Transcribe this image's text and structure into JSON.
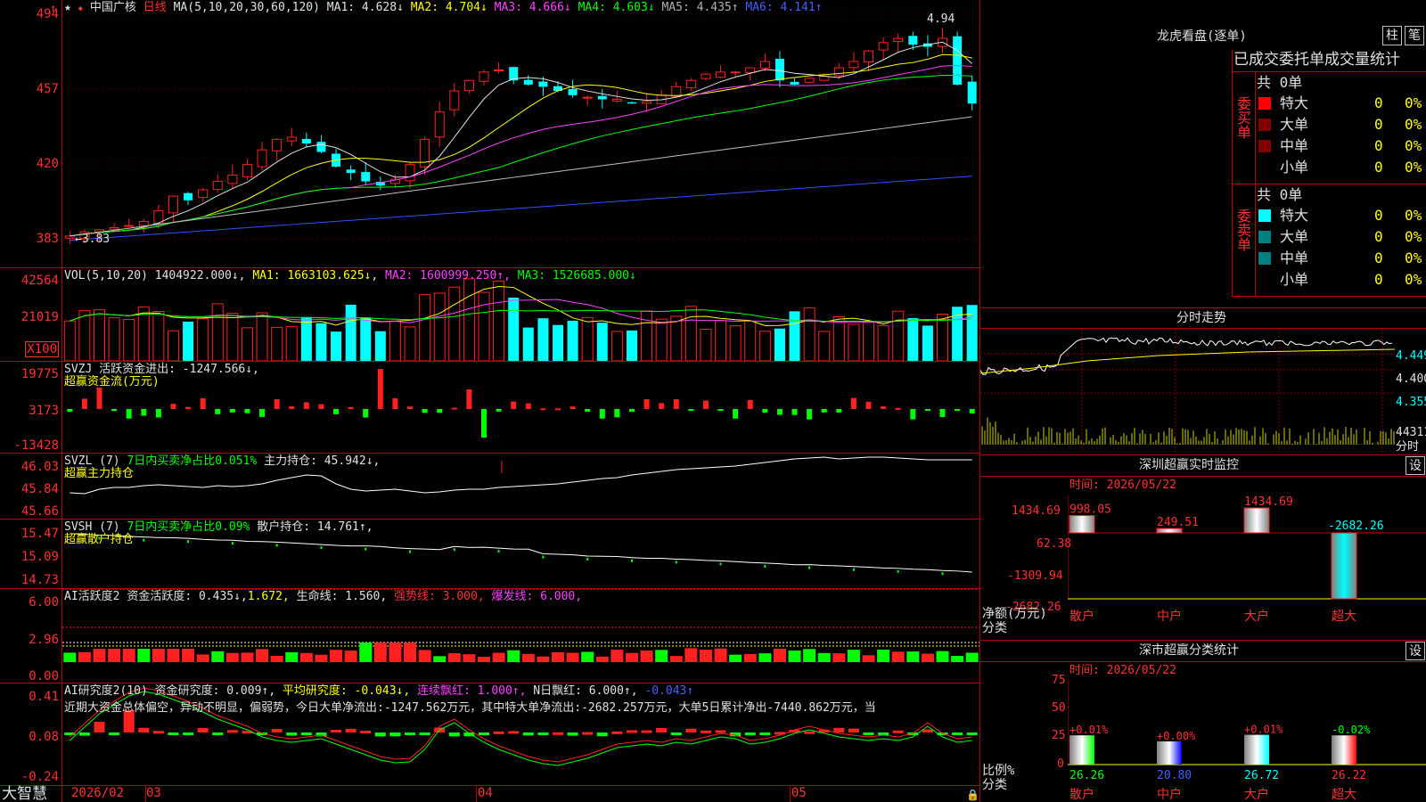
{
  "stock": {
    "name": "中国广核",
    "period": "日线",
    "star": "★"
  },
  "price_axis": [
    "494",
    "457",
    "420",
    "383"
  ],
  "ma_line": {
    "params": "MA(5,10,20,30,60,120)",
    "ma1": "MA1: 4.628↓",
    "ma2": "MA2: 4.704↓",
    "ma3": "MA3: 4.666↓",
    "ma4": "MA4: 4.603↓",
    "ma5": "MA5: 4.435↑",
    "ma6": "MA6: 4.141↑"
  },
  "high_label": "4.94",
  "low_label": "3.83",
  "vol": {
    "title": "VOL(5,10,20)",
    "value": "1404922.000↓,",
    "ma1": "MA1: 1663103.625↓,",
    "ma2": "MA2: 1600999.250↑,",
    "ma3": "MA3: 1526685.000↓",
    "axis": [
      "42564",
      "21019"
    ],
    "unit": "X100"
  },
  "svzj": {
    "title": "SVZJ  活跃资金进出: -1247.566↓,",
    "sub": "超赢资金流(万元)",
    "axis": [
      "19775",
      "3173",
      "-13428"
    ]
  },
  "svzl": {
    "title": "SVZL (7)",
    "t2": "7日内买卖净占比0.051%",
    "t3": "主力持仓: 45.942↓,",
    "sub": "超赢主力持仓",
    "axis": [
      "46.03",
      "45.84",
      "45.66"
    ]
  },
  "svsh": {
    "title": "SVSH (7)",
    "t2": "7日内买卖净占比0.09%",
    "t3": "散户持仓: 14.761↑,",
    "sub": "超赢散户持仓",
    "axis": [
      "15.47",
      "15.09",
      "14.73"
    ]
  },
  "ai1": {
    "title": "AI活跃度2",
    "t2": "资金活跃度: 0.435↓,",
    "t3": "1.672,",
    "t4": "生命线: 1.560,",
    "t5": "强势线: 3.000,",
    "t6": "爆发线: 6.000,",
    "axis": [
      "6.00",
      "2.96",
      "0.00"
    ]
  },
  "ai2": {
    "title": "AI研究度2(10)",
    "t2": "资金研究度: 0.009↑,",
    "t3": "平均研究度: -0.043↓,",
    "t4": "连续飘红: 1.000↑,",
    "t5": "N日飘红: 6.000↑,",
    "t6": "-0.043↑",
    "desc": "近期大资金总体偏空，异动不明显，偏弱势，今日大单净流出:-1247.562万元，其中特大单净流出:-2682.257万元，大单5日累计净出-7440.862万元，当",
    "axis": [
      "0.41",
      "0.08",
      "-0.24"
    ]
  },
  "dates": {
    "brand": "大智慧",
    "d1": "2026/02",
    "d2": "03",
    "d3": "04",
    "d4": "05"
  },
  "lhb": {
    "title": "龙虎看盘(逐单)",
    "btn1": "柱",
    "btn2": "笔",
    "header": "已成交委托单成交量统计",
    "buy": {
      "side": "委买单",
      "total": "共 0单",
      "rows": [
        {
          "n": "特大",
          "v": "0",
          "p": "0%",
          "c": "#ff0000"
        },
        {
          "n": "大单",
          "v": "0",
          "p": "0%",
          "c": "#800000"
        },
        {
          "n": "中单",
          "v": "0",
          "p": "0%",
          "c": "#800000"
        },
        {
          "n": "小单",
          "v": "0",
          "p": "0%",
          "c": "#000000"
        }
      ]
    },
    "sell": {
      "side": "委卖单",
      "total": "共 0单",
      "rows": [
        {
          "n": "特大",
          "v": "0",
          "p": "0%",
          "c": "#00ffff"
        },
        {
          "n": "大单",
          "v": "0",
          "p": "0%",
          "c": "#008080"
        },
        {
          "n": "中单",
          "v": "0",
          "p": "0%",
          "c": "#008080"
        },
        {
          "n": "小单",
          "v": "0",
          "p": "0%",
          "c": "#000000"
        }
      ]
    }
  },
  "fenshi": {
    "title": "分时走势",
    "axis": [
      "4.449",
      "4.400",
      "4.355"
    ],
    "vol": "44311",
    "unit": "分时"
  },
  "monitor": {
    "title": "深圳超赢实时监控",
    "btn": "设",
    "time": "时间: 2026/05/22",
    "axis": [
      "1434.69",
      "62.38",
      "-1309.94",
      "-2682.26"
    ],
    "ylabel": "净额(万元)",
    "xlabel": "分类",
    "bars": [
      {
        "cat": "散户",
        "v": "998.05",
        "val": 998.05
      },
      {
        "cat": "中户",
        "v": "249.51",
        "val": 249.51
      },
      {
        "cat": "大户",
        "v": "1434.69",
        "val": 1434.69
      },
      {
        "cat": "超大",
        "v": "-2682.26",
        "val": -2682.26
      }
    ]
  },
  "classify": {
    "title": "深市超赢分类统计",
    "btn": "设",
    "time": "时间: 2026/05/22",
    "axis": [
      "75",
      "50",
      "25",
      "0"
    ],
    "ylabel": "比例%",
    "xlabel": "分类",
    "bars": [
      {
        "cat": "散户",
        "top": "+0.01%",
        "val": "26.26",
        "n": 26.26,
        "col": "#00ff00"
      },
      {
        "cat": "中户",
        "top": "+0.00%",
        "val": "20.80",
        "n": 20.8,
        "col": "#0000ff"
      },
      {
        "cat": "大户",
        "top": "+0.01%",
        "val": "26.72",
        "n": 26.72,
        "col": "#00ffff"
      },
      {
        "cat": "超大",
        "top": "-0.02%",
        "val": "26.22",
        "n": 26.22,
        "col": "#ff0000"
      }
    ]
  }
}
